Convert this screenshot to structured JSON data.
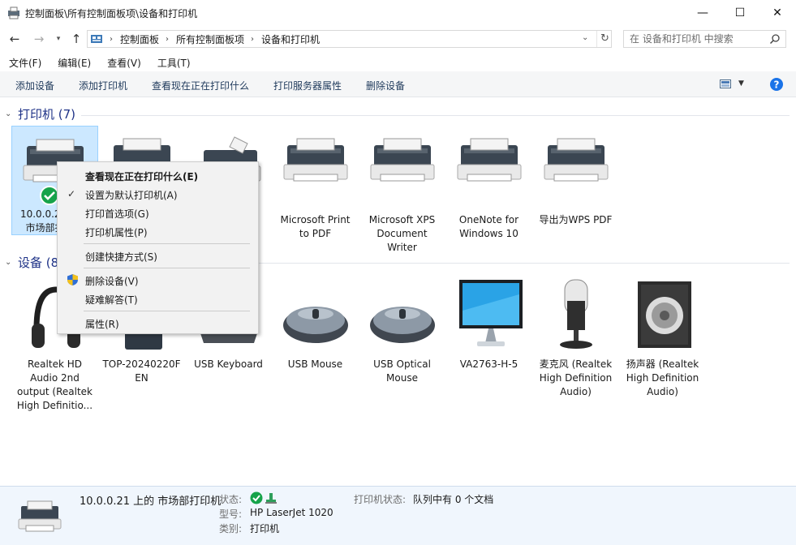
{
  "window": {
    "title": "控制面板\\所有控制面板项\\设备和打印机",
    "min_glyph": "—",
    "max_glyph": "☐",
    "close_glyph": "✕"
  },
  "address": {
    "crumbs": [
      "控制面板",
      "所有控制面板项",
      "设备和打印机"
    ],
    "search_placeholder": "在 设备和打印机 中搜索"
  },
  "menubar": [
    "文件(F)",
    "编辑(E)",
    "查看(V)",
    "工具(T)"
  ],
  "commands": [
    "添加设备",
    "添加打印机",
    "查看现在正在打印什么",
    "打印服务器属性",
    "删除设备"
  ],
  "groups": {
    "printers": {
      "title": "打印机 (7)"
    },
    "devices": {
      "title": "设备 (8)"
    }
  },
  "printers": [
    {
      "label1": "10.0.0.21 上的",
      "label2": "市场部打印机"
    },
    {
      "label1": "",
      "label2": ""
    },
    {
      "label1": "",
      "label2": ""
    },
    {
      "label1": "Microsoft Print",
      "label2": "to PDF"
    },
    {
      "label1": "Microsoft XPS",
      "label2": "Document",
      "label3": "Writer"
    },
    {
      "label1": "OneNote for",
      "label2": "Windows 10"
    },
    {
      "label1": "导出为WPS PDF"
    }
  ],
  "devices": [
    {
      "label1": "Realtek HD",
      "label2": "Audio 2nd",
      "label3": "output (Realtek",
      "label4": "High Definitio..."
    },
    {
      "label1": "TOP-20240220F",
      "label2": "EN"
    },
    {
      "label1": "USB Keyboard"
    },
    {
      "label1": "USB Mouse"
    },
    {
      "label1": "USB Optical",
      "label2": "Mouse"
    },
    {
      "label1": "VA2763-H-5"
    },
    {
      "label1": "麦克风 (Realtek",
      "label2": "High Definition",
      "label3": "Audio)"
    },
    {
      "label1": "扬声器 (Realtek",
      "label2": "High Definition",
      "label3": "Audio)"
    }
  ],
  "context_menu": {
    "items": [
      "查看现在正在打印什么(E)",
      "设置为默认打印机(A)",
      "打印首选项(G)",
      "打印机属性(P)",
      "创建快捷方式(S)",
      "删除设备(V)",
      "疑难解答(T)",
      "属性(R)"
    ],
    "check_glyph": "✓"
  },
  "details": {
    "name": "10.0.0.21 上的 市场部打印机",
    "status_label": "状态:",
    "model_label": "型号:",
    "model": "HP LaserJet 1020",
    "category_label": "类别:",
    "category": "打印机",
    "printer_status_label": "打印机状态:",
    "printer_status": "队列中有 0 个文档"
  },
  "colors": {
    "accent": "#1e3287",
    "selection": "#cce8ff",
    "details_bg": "#f0f6fd",
    "help": "#1a73e8",
    "check_green": "#16a34a"
  }
}
